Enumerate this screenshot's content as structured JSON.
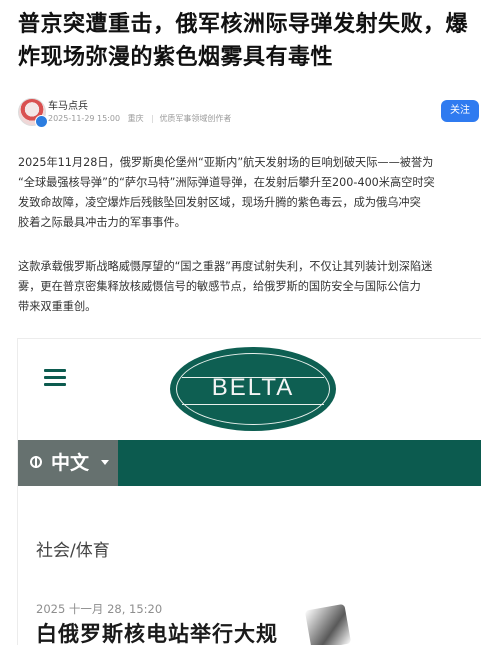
{
  "article": {
    "headline": "普京突遭重击，俄军核洲际导弹发射失败，爆炸现场弥漫的紫色烟雾具有毒性"
  },
  "author": {
    "name": "车马点兵",
    "date": "2025-11-29 15:00",
    "location": "重庆",
    "badge": "优质军事领域创作者",
    "follow_label": "关注"
  },
  "body": {
    "paragraph_1": "2025年11月28日，俄罗斯奥伦堡州“亚斯内”航天发射场的巨响划破天际——被誉为\n“全球最强核导弹”的“萨尔马特”洲际弹道导弹，在发射后攀升至200-400米高空时突\n发致命故障，凌空爆炸后残骸坠回发射区域，现场升腾的紫色毒云，成为俄乌冲突\n胶着之际最具冲击力的军事事件。",
    "paragraph_2": "这款承载俄罗斯战略威慑厚望的“国之重器”再度试射失利，不仅让其列装计划深陷迷\n雾，更在普京密集释放核威慑信号的敏感节点，给俄罗斯的国防安全与国际公信力\n带来双重重创。"
  },
  "embed": {
    "logo_text": "BELTA",
    "language_label": "中文",
    "category": "社会/体育",
    "date": "2025 十一月 28, 15:20",
    "title": "白俄罗斯核电站举行大规"
  },
  "colors": {
    "brand_green": "#0c5b4f",
    "tab_gray": "#66716f",
    "follow_blue": "#2f7bf0"
  }
}
